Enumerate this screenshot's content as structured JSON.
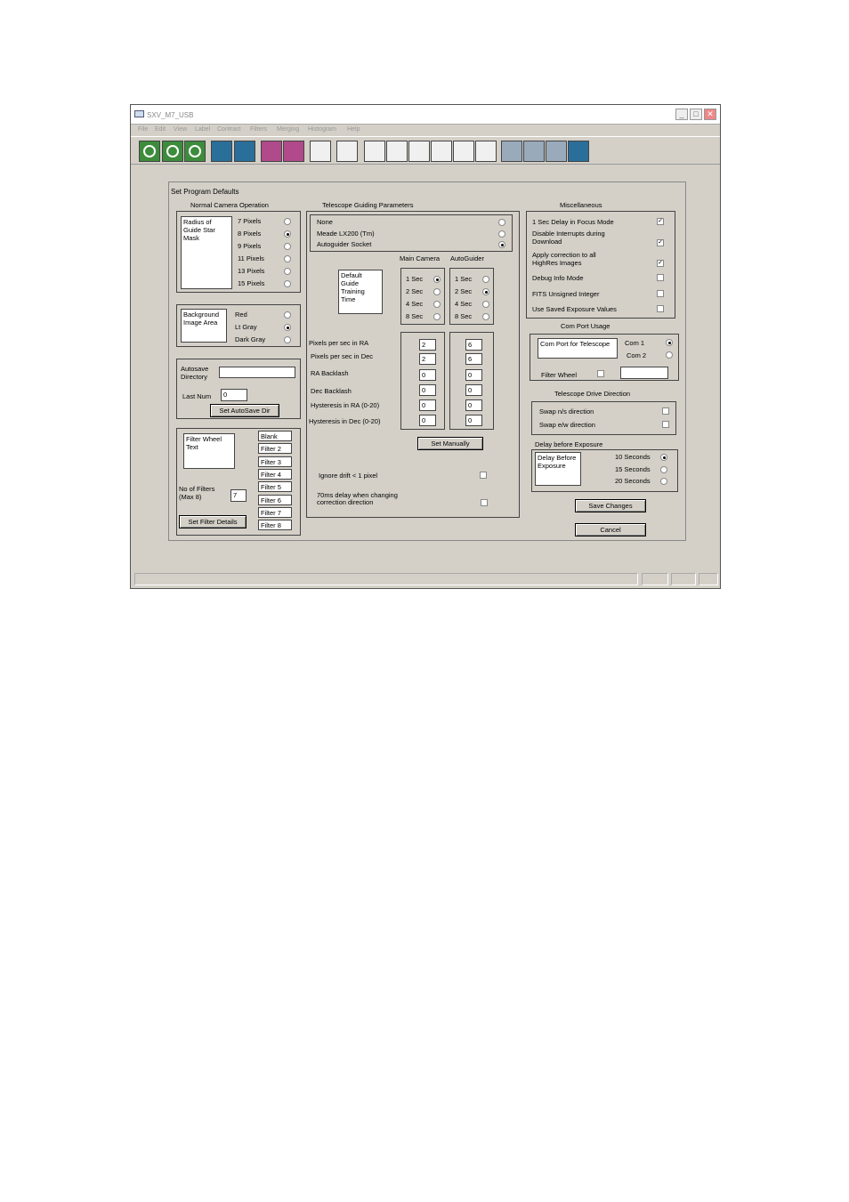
{
  "window": {
    "title": "SXV_M7_USB",
    "min": "_",
    "max": "□",
    "close": "✕"
  },
  "menu": [
    "File",
    "Edit",
    "View",
    "Label",
    "Contrast",
    "Filters",
    "Merging",
    "Histogram",
    "Help"
  ],
  "dialog": {
    "title": "Set Program Defaults"
  },
  "normal": {
    "title": "Normal Camera Operation",
    "mask_label": "Radius of Guide Star Mask",
    "radius": [
      "7 Pixels",
      "8 Pixels",
      "9 Pixels",
      "11 Pixels",
      "13 Pixels",
      "15 Pixels"
    ],
    "bg_label": "Background Image Area",
    "bg": [
      "Red",
      "Lt Gray",
      "Dark Gray"
    ],
    "autosave_label": "Autosave Directory",
    "autosave_value": "",
    "lastnum_label": "Last Num",
    "lastnum_value": "0",
    "autosave_btn": "Set AutoSave Dir",
    "fw_label": "Filter Wheel Text",
    "filters": [
      "Blank",
      "Filter 2",
      "Filter 3",
      "Filter 4",
      "Filter 5",
      "Filter 6",
      "Filter 7",
      "Filter 8"
    ],
    "nfilt_label": "No of Filters (Max 8)",
    "nfilt_value": "7",
    "fw_btn": "Set Filter Details"
  },
  "tele": {
    "title": "Telescope Guiding Parameters",
    "mount": [
      "None",
      "Meade LX200 (Tm)",
      "Autoguider Socket"
    ],
    "col_main": "Main Camera",
    "col_auto": "AutoGuider",
    "train_label": "Default Guide Training Time",
    "times": [
      "1 Sec",
      "2 Sec",
      "4 Sec",
      "8 Sec"
    ],
    "params": [
      "Pixels per sec in RA",
      "Pixels per sec in Dec",
      "RA Backlash",
      "Dec Backlash",
      "Hysteresis in RA (0-20)",
      "Hysteresis in Dec (0-20)"
    ],
    "main_vals": [
      "2",
      "2",
      "0",
      "0",
      "0",
      "0"
    ],
    "auto_vals": [
      "6",
      "6",
      "0",
      "0",
      "0",
      "0"
    ],
    "manual_btn": "Set Manually",
    "ignore": "Ignore drift < 1 pixel",
    "delay70": "70ms delay when changing correction direction"
  },
  "misc": {
    "title": "Miscellaneous",
    "items": [
      "1 Sec Delay in Focus Mode",
      "Disable Interrupts during Download",
      "Apply correction to all HighRes Images",
      "Debug Info Mode",
      "FITS Unsigned Integer",
      "Use Saved Exposure Values"
    ],
    "checked": [
      "✓",
      "✓",
      "✓",
      "",
      "",
      ""
    ]
  },
  "com": {
    "title": "Com Port Usage",
    "label": "Com Port for Telescope",
    "opts": [
      "Com 1",
      "Com 2"
    ],
    "fw": "Filter Wheel",
    "fw_value": ""
  },
  "drive": {
    "title": "Telescope Drive Direction",
    "ns": "Swap n/s direction",
    "ew": "Swap e/w direction"
  },
  "delay": {
    "title": "Delay before Exposure",
    "label": "Delay Before Exposure",
    "opts": [
      "10 Seconds",
      "15 Seconds",
      "20 Seconds"
    ]
  },
  "buttons": {
    "save": "Save Changes",
    "cancel": "Cancel"
  }
}
